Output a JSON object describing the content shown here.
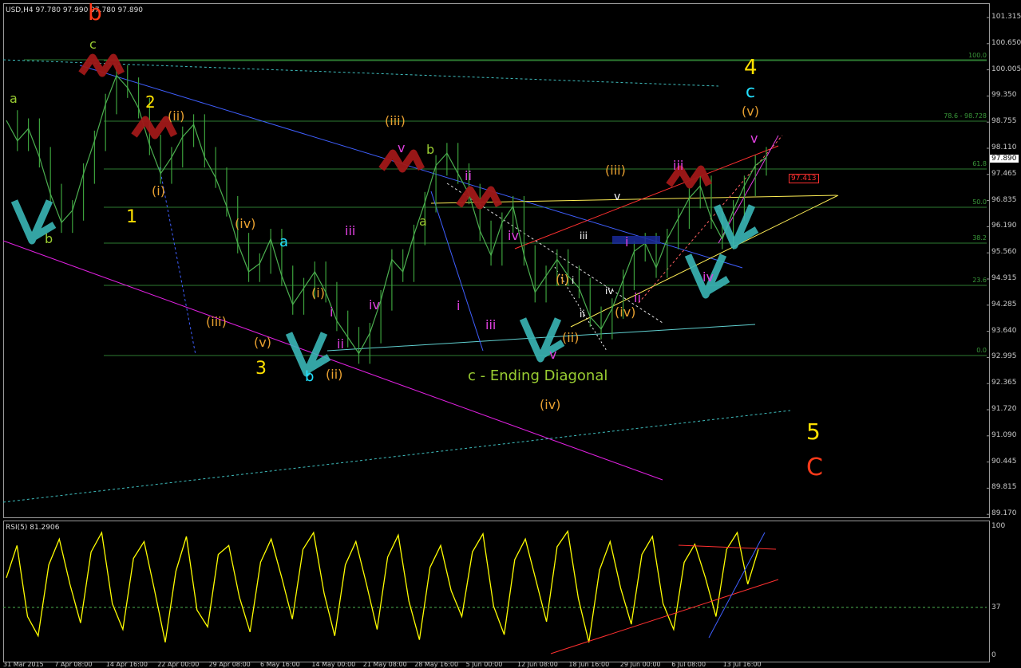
{
  "header": {
    "symbol": "USD,H4",
    "ohlc": "97.780 97.990 97.780 97.890",
    "rsi_label": "RSI(5) 81.2906"
  },
  "price_axis": [
    "101.315",
    "100.650",
    "100.005",
    "99.350",
    "98.755",
    "98.110",
    "97.465",
    "96.835",
    "96.190",
    "95.560",
    "94.915",
    "94.285",
    "93.640",
    "92.995",
    "92.365",
    "91.720",
    "91.090",
    "90.445",
    "89.815",
    "89.170"
  ],
  "rsi_axis": [
    "100",
    "37",
    "0"
  ],
  "date_axis": [
    "31 Mar 2015",
    "7 Apr 08:00",
    "14 Apr 16:00",
    "22 Apr 00:00",
    "29 Apr 08:00",
    "6 May 16:00",
    "14 May 00:00",
    "21 May 08:00",
    "28 May 16:00",
    "5 Jun 00:00",
    "12 Jun 08:00",
    "18 Jun 16:00",
    "29 Jun 00:00",
    "6 Jul 08:00",
    "13 Jul 16:00"
  ],
  "fib_levels": [
    "100.0",
    "78.6 - 98.728",
    "61.8",
    "50.0",
    "38.2",
    "23.6",
    "0.0"
  ],
  "current_price": "97.890",
  "target_price": "97.413",
  "annotations": [
    {
      "text": "b",
      "color": "#ff3a1a"
    },
    {
      "text": "c",
      "color": "#9acd32"
    },
    {
      "text": "a",
      "color": "#9acd32"
    },
    {
      "text": "b",
      "color": "#9acd32"
    },
    {
      "text": "2",
      "color": "#ffe000"
    },
    {
      "text": "(ii)",
      "color": "#e8a030"
    },
    {
      "text": "(i)",
      "color": "#e8a030"
    },
    {
      "text": "1",
      "color": "#ffe000"
    },
    {
      "text": "(iv)",
      "color": "#e8a030"
    },
    {
      "text": "(iii)",
      "color": "#e8a030"
    },
    {
      "text": "(v)",
      "color": "#e8a030"
    },
    {
      "text": "3",
      "color": "#ffe000"
    },
    {
      "text": "a",
      "color": "#22e0ff"
    },
    {
      "text": "(i)",
      "color": "#e8a030"
    },
    {
      "text": "i",
      "color": "#e040e0"
    },
    {
      "text": "ii",
      "color": "#e040e0"
    },
    {
      "text": "b",
      "color": "#22e0ff"
    },
    {
      "text": "(ii)",
      "color": "#e8a030"
    },
    {
      "text": "iii",
      "color": "#e040e0"
    },
    {
      "text": "iv",
      "color": "#e040e0"
    },
    {
      "text": "(iii)",
      "color": "#e8a030"
    },
    {
      "text": "v",
      "color": "#e040e0"
    },
    {
      "text": "b",
      "color": "#9acd32"
    },
    {
      "text": "a",
      "color": "#9acd32"
    },
    {
      "text": "ii",
      "color": "#e040e0"
    },
    {
      "text": "i",
      "color": "#e040e0"
    },
    {
      "text": "iii",
      "color": "#e040e0"
    },
    {
      "text": "iv",
      "color": "#e040e0"
    },
    {
      "text": "c - Ending Diagonal",
      "color": "#9acd32"
    },
    {
      "text": "(iv)",
      "color": "#e8a030"
    },
    {
      "text": "v",
      "color": "#e040e0"
    },
    {
      "text": "(i)",
      "color": "#e8a030"
    },
    {
      "text": "i",
      "color": "#ffffff"
    },
    {
      "text": "ii",
      "color": "#ffffff"
    },
    {
      "text": "(ii)",
      "color": "#e8a030"
    },
    {
      "text": "iii",
      "color": "#ffffff"
    },
    {
      "text": "iv",
      "color": "#ffffff"
    },
    {
      "text": "(iii)",
      "color": "#e8a030"
    },
    {
      "text": "v",
      "color": "#ffffff"
    },
    {
      "text": "(iv)",
      "color": "#e8a030"
    },
    {
      "text": "i",
      "color": "#e040e0"
    },
    {
      "text": "ii",
      "color": "#e040e0"
    },
    {
      "text": "iii",
      "color": "#e040e0"
    },
    {
      "text": "iv",
      "color": "#e040e0"
    },
    {
      "text": "v",
      "color": "#e040e0"
    },
    {
      "text": "(v)",
      "color": "#e8a030"
    },
    {
      "text": "c",
      "color": "#22e0ff"
    },
    {
      "text": "4",
      "color": "#ffe000"
    },
    {
      "text": "5",
      "color": "#ffe000"
    },
    {
      "text": "C",
      "color": "#ff3a1a"
    }
  ],
  "chart_data": [
    {
      "type": "line",
      "title": "USD,H4",
      "ylim": [
        89.17,
        101.315
      ],
      "series": [
        {
          "values": [
            98.8,
            98.3,
            98.6,
            97.9,
            97.0,
            96.3,
            96.6,
            97.5,
            98.3,
            99.2,
            99.9,
            99.6,
            99.1,
            98.2,
            97.5,
            97.9,
            98.4,
            98.7,
            97.9,
            97.4,
            96.7,
            95.8,
            95.1,
            95.3,
            95.9,
            95.0,
            94.3,
            94.7,
            95.1,
            94.6,
            93.9,
            93.5,
            93.1,
            93.6,
            94.4,
            95.4,
            95.1,
            96.0,
            96.8,
            97.7,
            98.0,
            97.5,
            97.0,
            96.1,
            95.5,
            96.3,
            96.7,
            95.5,
            94.6,
            95.0,
            95.4,
            95.0,
            94.7,
            94.0,
            93.7,
            94.2,
            94.9,
            95.6,
            95.8,
            95.2,
            95.9,
            96.4,
            96.9,
            97.2,
            96.4,
            95.9,
            96.6,
            97.2,
            97.7,
            97.9
          ]
        }
      ],
      "fib_levels_pct": [
        100.0,
        78.6,
        61.8,
        50.0,
        38.2,
        23.6,
        0.0
      ]
    },
    {
      "type": "line",
      "title": "RSI(5) 81.2906",
      "ylim": [
        0,
        100
      ],
      "reference_level": 37,
      "series": [
        {
          "values": [
            60,
            85,
            30,
            15,
            70,
            90,
            55,
            25,
            80,
            95,
            40,
            20,
            75,
            88,
            50,
            10,
            65,
            92,
            35,
            22,
            78,
            85,
            45,
            18,
            72,
            90,
            60,
            28,
            82,
            95,
            48,
            15,
            70,
            88,
            55,
            20,
            76,
            93,
            42,
            12,
            68,
            85,
            50,
            30,
            80,
            94,
            38,
            16,
            74,
            90,
            58,
            26,
            84,
            96,
            44,
            10,
            66,
            88,
            52,
            24,
            78,
            92,
            40,
            20,
            72,
            86,
            60,
            30,
            82,
            95,
            55,
            82
          ]
        }
      ]
    }
  ]
}
